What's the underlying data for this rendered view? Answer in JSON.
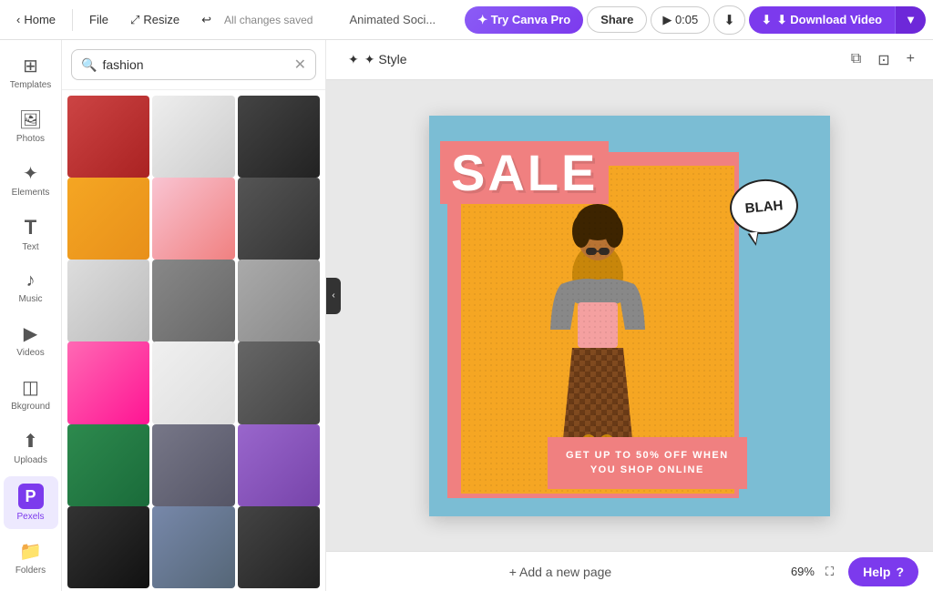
{
  "topnav": {
    "home_label": "Home",
    "file_label": "File",
    "resize_label": "Resize",
    "undo_label": "↩",
    "saved_label": "All changes saved",
    "project_title": "Animated Soci...",
    "try_pro_label": "✦ Try Canva Pro",
    "share_label": "Share",
    "play_label": "▶ 0:05",
    "download_icon_label": "⬇",
    "download_video_label": "⬇  Download Video",
    "download_caret_label": "▼"
  },
  "sidebar": {
    "items": [
      {
        "id": "templates",
        "label": "Templates",
        "icon": "⊞"
      },
      {
        "id": "photos",
        "label": "Photos",
        "icon": "🖼"
      },
      {
        "id": "elements",
        "label": "Elements",
        "icon": "✦"
      },
      {
        "id": "text",
        "label": "Text",
        "icon": "T"
      },
      {
        "id": "music",
        "label": "Music",
        "icon": "♪"
      },
      {
        "id": "videos",
        "label": "Videos",
        "icon": "▶"
      },
      {
        "id": "background",
        "label": "Bkground",
        "icon": "◫"
      },
      {
        "id": "uploads",
        "label": "Uploads",
        "icon": "⬆"
      },
      {
        "id": "pexels",
        "label": "Pexels",
        "icon": "P",
        "active": true
      },
      {
        "id": "folders",
        "label": "Folders",
        "icon": "📁"
      }
    ]
  },
  "search": {
    "query": "fashion",
    "placeholder": "Search"
  },
  "canvas": {
    "style_label": "✦ Style",
    "sale_text": "SALE",
    "blah_text": "BLAH",
    "bottom_line1": "GET UP TO 50% OFF WHEN",
    "bottom_line2": "YOU SHOP ONLINE"
  },
  "bottombar": {
    "add_page_label": "+ Add a new page",
    "zoom_level": "69%",
    "fullscreen_icon": "⛶",
    "help_label": "Help",
    "question_mark": "?"
  }
}
